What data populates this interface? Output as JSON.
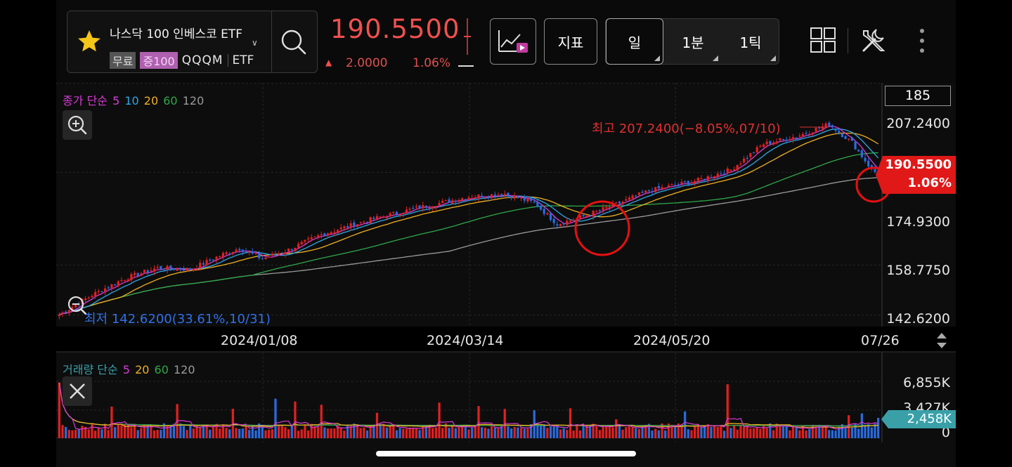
{
  "symbol": {
    "name": "나스닥 100 인베스코 ETF",
    "tag_free": "무료",
    "tag_leverage": "증100",
    "code": "QQQM",
    "type": "ETF"
  },
  "quote": {
    "price": "190.5500",
    "change": "2.0000",
    "change_pct": "1.06%",
    "color_up": "#f05050"
  },
  "toolbar": {
    "indicator_label": "지표",
    "periods": [
      "일",
      "1분",
      "1틱"
    ],
    "active_period": "일"
  },
  "price_chart": {
    "legend_title": "종가 단순",
    "ma_periods": [
      "5",
      "10",
      "20",
      "60",
      "120"
    ],
    "ma_colors": [
      "#d83cd8",
      "#2ea8e8",
      "#f0b020",
      "#2ea84a",
      "#9a9a9a"
    ],
    "candle_count": "185",
    "y_ticks": [
      "207.2400",
      "174.9300",
      "158.7750",
      "142.6200"
    ],
    "current_price": "190.5500",
    "current_pct": "1.06%",
    "high_label": "최고 207.2400(−8.05%,07/10)",
    "low_label": "최저 142.6200(33.61%,10/31)",
    "dates": [
      "2024/01/08",
      "2024/03/14",
      "2024/05/20",
      "07/26"
    ],
    "up_color": "#e02020",
    "down_color": "#2a6adc"
  },
  "volume_chart": {
    "legend_title": "거래량 단순",
    "ma_periods": [
      "5",
      "20",
      "60",
      "120"
    ],
    "ma_colors": [
      "#d83cd8",
      "#f0b020",
      "#2ea84a",
      "#9a9a9a"
    ],
    "y_ticks": [
      "6,855K",
      "3,427K",
      "0"
    ],
    "current_volume": "2,458K"
  },
  "chart_data": {
    "type": "candlestick",
    "x_range": [
      "10/31",
      "07/26"
    ],
    "ylim": [
      142.62,
      207.24
    ],
    "close_anchors": [
      {
        "index": 0,
        "close": 144.0
      },
      {
        "index": 10,
        "close": 150.5
      },
      {
        "index": 20,
        "close": 156.0
      },
      {
        "index": 30,
        "close": 159.5
      },
      {
        "index": 40,
        "close": 159.0
      },
      {
        "index": 50,
        "close": 164.0
      },
      {
        "index": 55,
        "close": 166.0
      },
      {
        "index": 62,
        "close": 162.5
      },
      {
        "index": 70,
        "close": 165.5
      },
      {
        "index": 80,
        "close": 170.5
      },
      {
        "index": 95,
        "close": 175.5
      },
      {
        "index": 110,
        "close": 179.5
      },
      {
        "index": 125,
        "close": 183.0
      },
      {
        "index": 136,
        "close": 184.0
      },
      {
        "index": 145,
        "close": 181.0
      },
      {
        "index": 152,
        "close": 174.0
      },
      {
        "index": 160,
        "close": 176.5
      },
      {
        "index": 170,
        "close": 180.5
      },
      {
        "index": 180,
        "close": 185.0
      },
      {
        "index": 195,
        "close": 188.5
      },
      {
        "index": 205,
        "close": 192.0
      },
      {
        "index": 215,
        "close": 200.5
      },
      {
        "index": 225,
        "close": 203.0
      },
      {
        "index": 235,
        "close": 207.0
      },
      {
        "index": 242,
        "close": 201.0
      },
      {
        "index": 248,
        "close": 192.0
      },
      {
        "index": 250,
        "close": 190.55
      }
    ],
    "volume_ylim": [
      0,
      6855
    ],
    "last_volume": 2458
  }
}
